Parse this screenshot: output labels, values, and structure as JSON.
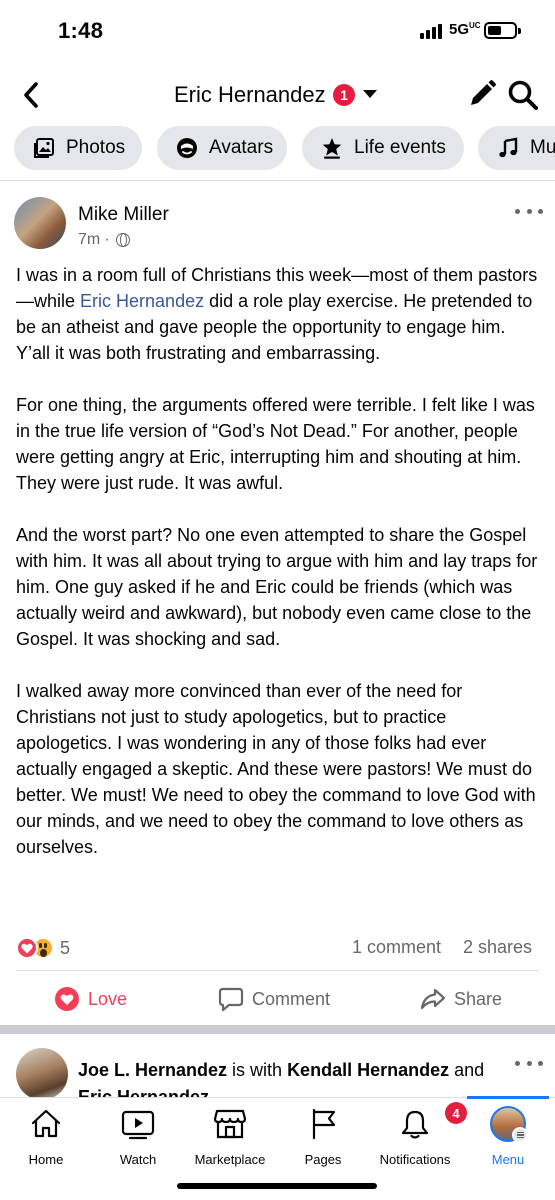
{
  "status_bar": {
    "time": "1:48",
    "network": "5G",
    "network_suffix": "UC",
    "icons": [
      "signal-icon",
      "battery-icon"
    ]
  },
  "header": {
    "title": "Eric Hernandez",
    "badge_count": "1",
    "icons": [
      "back-chevron-icon",
      "dropdown-caret-icon",
      "pencil-icon",
      "search-icon"
    ]
  },
  "chips": [
    {
      "label": "Photos",
      "icon": "photos-icon"
    },
    {
      "label": "Avatars",
      "icon": "avatar-icon"
    },
    {
      "label": "Life events",
      "icon": "star-flag-icon"
    },
    {
      "label": "Music",
      "icon": "music-note-icon"
    }
  ],
  "post": {
    "author": "Mike Miller",
    "time": "7m",
    "meta_separator": "·",
    "privacy_icon": "globe-icon",
    "body": {
      "p1_before": "I was in a room full of Christians this week—most of them pastors—while ",
      "p1_mention": "Eric Hernandez",
      "p1_after": " did a role play exercise. He pretended to be an atheist and gave people the opportunity to engage him. Y’all it was both frustrating and embarrassing.",
      "p2": "For one thing, the arguments offered were terrible. I felt like I was in the true life version of “God’s Not Dead.” For another, people were getting angry at Eric, interrupting him and shouting at him. They were just rude. It was awful.",
      "p3": "And the worst part? No one even attempted to share the Gospel with him. It was all about trying to argue with him and lay traps for him. One guy asked if he and Eric could be friends (which was actually weird and awkward), but nobody even came close to the Gospel. It was shocking and sad.",
      "p4": "I walked away more convinced than ever of the need for Christians not just to study apologetics, but to practice apologetics. I was wondering in any of those folks had ever actually engaged a skeptic. And these were pastors! We must do better. We must! We need to obey the command to love God with our minds, and we need to obey the command to love others as ourselves."
    },
    "reactions": {
      "count": "5",
      "types": [
        "love",
        "wow"
      ]
    },
    "comments": "1 comment",
    "shares": "2 shares",
    "actions": {
      "love": "Love",
      "comment": "Comment",
      "share": "Share"
    },
    "colors": {
      "love": "#f33e58",
      "mention": "#385898"
    }
  },
  "next_post": {
    "author": "Joe L. Hernandez",
    "connector": " is with ",
    "with1": "Kendall Hernandez",
    "and": " and ",
    "with2": "Eric Hernandez",
    "tail": "."
  },
  "tab_bar": {
    "tabs": [
      {
        "label": "Home",
        "icon": "home-icon"
      },
      {
        "label": "Watch",
        "icon": "video-play-icon"
      },
      {
        "label": "Marketplace",
        "icon": "storefront-icon"
      },
      {
        "label": "Pages",
        "icon": "flag-icon"
      },
      {
        "label": "Notifications",
        "icon": "bell-icon",
        "badge": "4"
      },
      {
        "label": "Menu",
        "icon": "profile-menu-icon",
        "active": true
      }
    ],
    "active_color": "#1877f2"
  }
}
